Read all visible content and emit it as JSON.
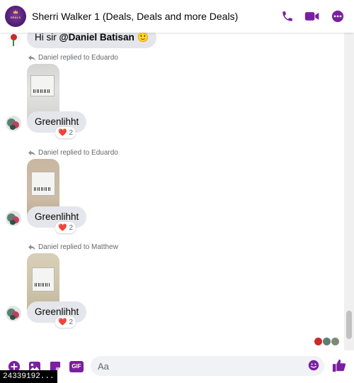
{
  "header": {
    "title": "Sherri Walker 1 (Deals, Deals and more Deals)",
    "avatar_text": "DEALS",
    "icons": [
      "phone-icon",
      "video-call-icon",
      "more-options-icon"
    ],
    "accent": "#7b1fa2"
  },
  "messages": [
    {
      "type": "text",
      "prefix": "Hi sir ",
      "mention": "@Daniel Batisan",
      "emoji": "🙂"
    },
    {
      "type": "reply",
      "note": "Daniel replied to Eduardo",
      "text": "Greenlihht",
      "reaction_emoji": "❤️",
      "reaction_count": "2"
    },
    {
      "type": "reply",
      "note": "Daniel replied to Eduardo",
      "text": "Greenlihht",
      "reaction_emoji": "❤️",
      "reaction_count": "2"
    },
    {
      "type": "reply",
      "note": "Daniel replied to Matthew",
      "text": "Greenlihht",
      "reaction_emoji": "❤️",
      "reaction_count": "2"
    }
  ],
  "composer": {
    "placeholder": "Aa",
    "icons": [
      "add-icon",
      "image-icon",
      "sticker-icon",
      "gif-icon",
      "emoji-icon",
      "like-icon"
    ],
    "gif_label": "GIF"
  },
  "id_tag": "24339192..."
}
